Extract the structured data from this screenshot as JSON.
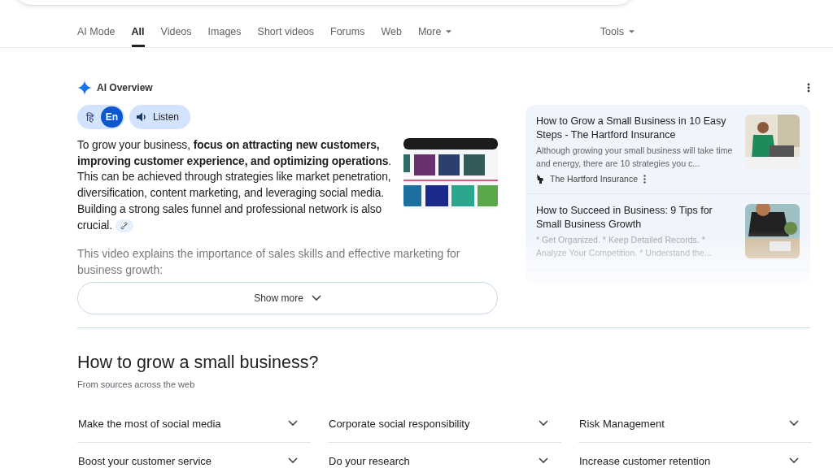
{
  "tabs": [
    {
      "label": "AI Mode",
      "selected": false,
      "dropdown": false
    },
    {
      "label": "All",
      "selected": true,
      "dropdown": false
    },
    {
      "label": "Videos",
      "selected": false,
      "dropdown": false
    },
    {
      "label": "Images",
      "selected": false,
      "dropdown": false
    },
    {
      "label": "Short videos",
      "selected": false,
      "dropdown": false
    },
    {
      "label": "Forums",
      "selected": false,
      "dropdown": false
    },
    {
      "label": "Web",
      "selected": false,
      "dropdown": false
    },
    {
      "label": "More",
      "selected": false,
      "dropdown": true
    }
  ],
  "tools": {
    "label": "Tools"
  },
  "ai_overview": {
    "title": "AI Overview",
    "languages": [
      {
        "label": "हि",
        "selected": false
      },
      {
        "label": "En",
        "selected": true
      }
    ],
    "listen": "Listen",
    "summary": "To grow your business, **focus on attracting new customers, improving customer experience, and optimizing operations**. This can be achieved through strategies like market penetration, diversification, content marketing, and leveraging social media. Building a strong sales funnel and professional network is also crucial.",
    "video_note": "This video explains the importance of sales skills and effective marketing for business growth:",
    "sources": [
      {
        "title": "How to Grow a Small Business in 10 Easy Steps - The Hartford Insurance",
        "snippet": "Although growing your small business will take time and energy, there are 10 strategies you c...",
        "site": "The Hartford Insurance"
      },
      {
        "title": "How to Succeed in Business: 9 Tips for Small Business Growth",
        "snippet": "* Get Organized. * Keep Detailed Records. * Analyze Your Competition. * Understand the..."
      }
    ],
    "show_more": "Show more"
  },
  "questions": {
    "title": "How to grow a small business?",
    "subtitle": "From sources across the web",
    "items": [
      "Make the most of social media",
      "Corporate social responsibility",
      "Risk Management",
      "Boost your customer service",
      "Do your research",
      "Increase customer retention"
    ]
  }
}
